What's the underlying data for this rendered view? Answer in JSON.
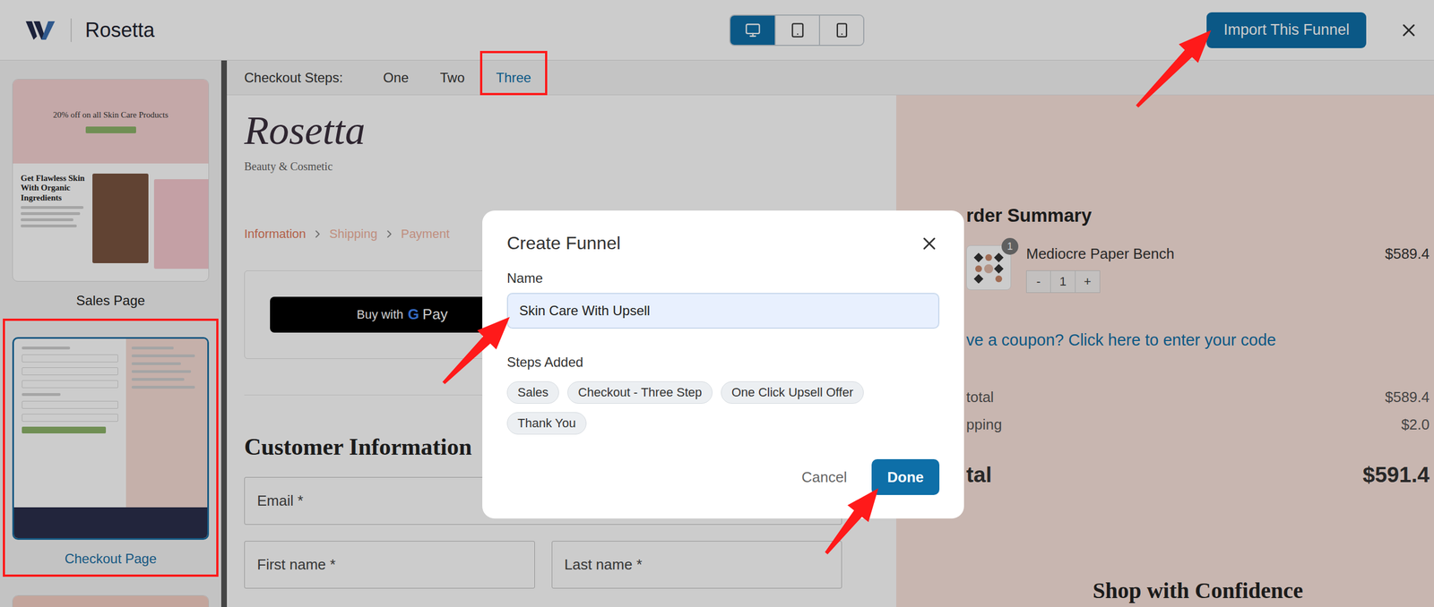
{
  "header": {
    "title": "Rosetta",
    "devices": [
      {
        "kind": "desktop",
        "selected": true
      },
      {
        "kind": "tablet",
        "selected": false
      },
      {
        "kind": "mobile",
        "selected": false
      }
    ],
    "import_button": "Import This Funnel"
  },
  "sidebar": {
    "items": [
      {
        "kind": "sales",
        "label": "Sales Page",
        "selected": false,
        "highlighted": false,
        "texts": [
          "20% off on all Skin Care Products",
          "Get Flawless Skin With Organic Ingredients"
        ]
      },
      {
        "kind": "checkout",
        "label": "Checkout Page",
        "selected": true,
        "highlighted": true,
        "texts": []
      },
      {
        "kind": "upsell",
        "selected": false,
        "highlighted": false,
        "texts": []
      }
    ]
  },
  "steps_bar": {
    "label": "Checkout Steps:",
    "tabs": [
      {
        "label": "One",
        "selected": false,
        "highlighted": false
      },
      {
        "label": "Two",
        "selected": false,
        "highlighted": false
      },
      {
        "label": "Three",
        "selected": true,
        "highlighted": true
      }
    ]
  },
  "page": {
    "brand": "Rosetta",
    "tagline": "Beauty & Cosmetic",
    "breadcrumb": [
      {
        "label": "Information",
        "active": true
      },
      {
        "label": "Shipping",
        "active": false
      },
      {
        "label": "Payment",
        "active": false
      }
    ],
    "express_button": {
      "prefix": "Buy with",
      "g": "G",
      "pay": "Pay"
    },
    "section_title": "Customer Information",
    "field_rows": [
      [
        "Email *"
      ],
      [
        "First name *",
        "Last name *"
      ]
    ]
  },
  "summary": {
    "title": "rder Summary",
    "product": {
      "name": "Mediocre Paper Bench",
      "price": "$589.4",
      "badge": "1",
      "minus": "-",
      "qty": "1",
      "plus": "+"
    },
    "coupon": "ve a coupon? Click here to enter your code",
    "lines": [
      {
        "kind": "normal",
        "label": "total",
        "value": "$589.4"
      },
      {
        "kind": "normal",
        "label": "pping",
        "value": "$2.0"
      },
      {
        "kind": "total",
        "label": "tal",
        "value": "$591.4"
      }
    ],
    "footer": "Shop with Confidence"
  },
  "modal": {
    "title": "Create Funnel",
    "name_label": "Name",
    "name_value": "Skin Care With Upsell",
    "steps_label": "Steps Added",
    "steps": [
      "Sales",
      "Checkout - Three Step",
      "One Click Upsell Offer",
      "Thank You"
    ],
    "cancel": "Cancel",
    "done": "Done"
  }
}
